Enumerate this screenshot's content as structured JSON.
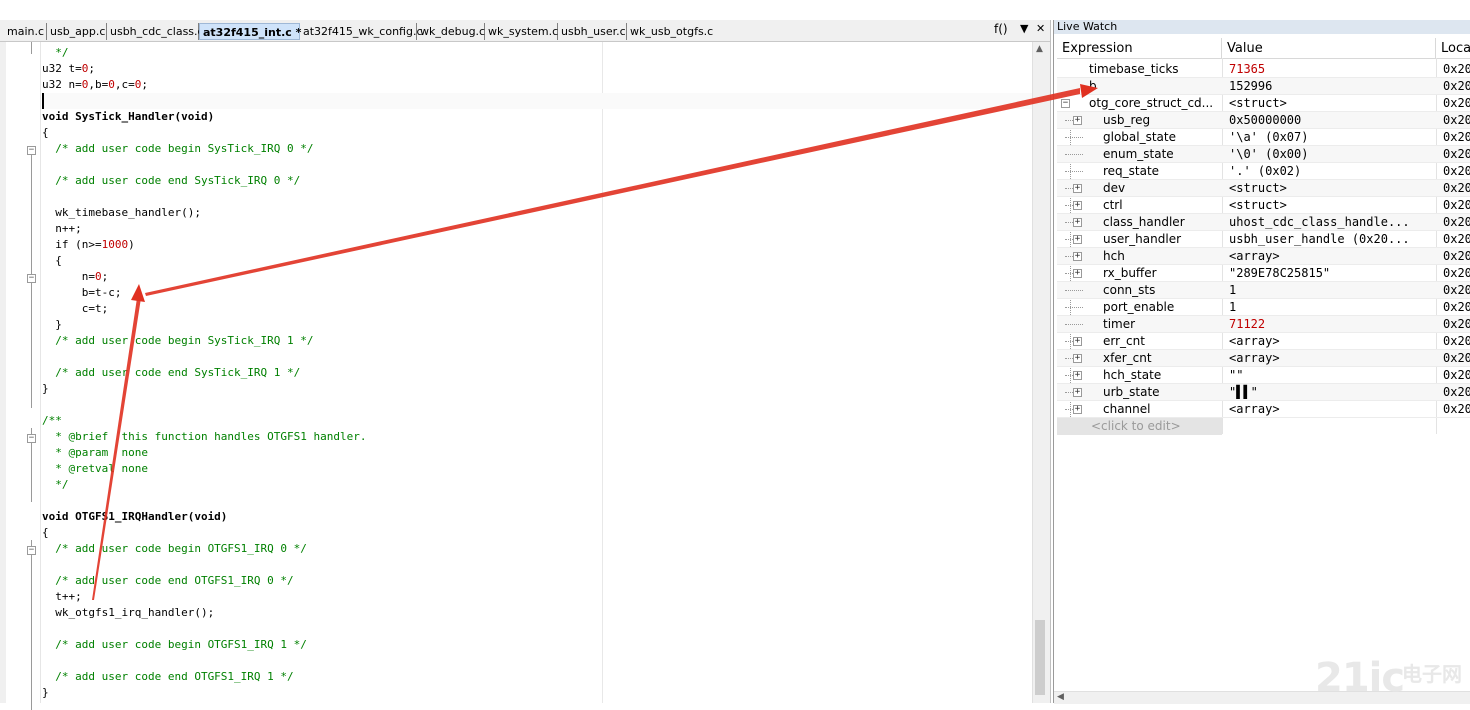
{
  "tabs": [
    {
      "label": "main.c"
    },
    {
      "label": "usb_app.c"
    },
    {
      "label": "usbh_cdc_class.c"
    },
    {
      "label": "at32f415_int.c *",
      "active": true
    },
    {
      "label": "at32f415_wk_config.c"
    },
    {
      "label": "wk_debug.c"
    },
    {
      "label": "wk_system.c"
    },
    {
      "label": "usbh_user.c"
    },
    {
      "label": "wk_usb_otgfs.c"
    }
  ],
  "func_selector": "f()",
  "code_lines": [
    "  */",
    "u32 t=0;",
    "u32 n=0,b=0,c=0;",
    "",
    "void SysTick_Handler(void)",
    "{",
    "  /* add user code begin SysTick_IRQ 0 */",
    "",
    "  /* add user code end SysTick_IRQ 0 */",
    "",
    "  wk_timebase_handler();",
    "  n++;",
    "  if (n>=1000)",
    "  {",
    "      n=0;",
    "      b=t-c;",
    "      c=t;",
    "  }",
    "  /* add user code begin SysTick_IRQ 1 */",
    "",
    "  /* add user code end SysTick_IRQ 1 */",
    "}",
    "",
    "/**",
    "  * @brief  this function handles OTGFS1 handler.",
    "  * @param  none",
    "  * @retval none",
    "  */",
    "",
    "void OTGFS1_IRQHandler(void)",
    "{",
    "  /* add user code begin OTGFS1_IRQ 0 */",
    "",
    "  /* add user code end OTGFS1_IRQ 0 */",
    "  t++;",
    "  wk_otgfs1_irq_handler();",
    "",
    "  /* add user code begin OTGFS1_IRQ 1 */",
    "",
    "  /* add user code end OTGFS1_IRQ 1 */",
    "}"
  ],
  "watch": {
    "title": "Live Watch",
    "headers": {
      "expression": "Expression",
      "value": "Value",
      "location": "Loca"
    },
    "rows": [
      {
        "name": "timebase_ticks",
        "value": "71365",
        "loc": "0x20",
        "changed": true
      },
      {
        "name": "b",
        "value": "152996",
        "loc": "0x20"
      },
      {
        "name": "otg_core_struct_cd...",
        "value": "<struct>",
        "loc": "0x20",
        "expand": "minus"
      },
      {
        "name": "usb_reg",
        "value": "0x50000000",
        "loc": "0x20",
        "expand": "plus"
      },
      {
        "name": "global_state",
        "value": "'\\a' (0x07)",
        "loc": "0x20"
      },
      {
        "name": "enum_state",
        "value": "'\\0' (0x00)",
        "loc": "0x20"
      },
      {
        "name": "req_state",
        "value": "'.' (0x02)",
        "loc": "0x20"
      },
      {
        "name": "dev",
        "value": "<struct>",
        "loc": "0x20",
        "expand": "plus"
      },
      {
        "name": "ctrl",
        "value": "<struct>",
        "loc": "0x20",
        "expand": "plus"
      },
      {
        "name": "class_handler",
        "value": "uhost_cdc_class_handle...",
        "loc": "0x20",
        "expand": "plus"
      },
      {
        "name": "user_handler",
        "value": "usbh_user_handle (0x20...",
        "loc": "0x20",
        "expand": "plus"
      },
      {
        "name": "hch",
        "value": "<array>",
        "loc": "0x20",
        "expand": "plus"
      },
      {
        "name": "rx_buffer",
        "value": "\"289E78C25815\"",
        "loc": "0x20",
        "expand": "plus"
      },
      {
        "name": "conn_sts",
        "value": "1",
        "loc": "0x20"
      },
      {
        "name": "port_enable",
        "value": "1",
        "loc": "0x20"
      },
      {
        "name": "timer",
        "value": "71122",
        "loc": "0x20",
        "changed": true
      },
      {
        "name": "err_cnt",
        "value": "<array>",
        "loc": "0x20",
        "expand": "plus"
      },
      {
        "name": "xfer_cnt",
        "value": "<array>",
        "loc": "0x20",
        "expand": "plus"
      },
      {
        "name": "hch_state",
        "value": "\"\"",
        "loc": "0x20",
        "expand": "plus"
      },
      {
        "name": "urb_state",
        "value": "\"▌▌\"",
        "loc": "0x20",
        "expand": "plus"
      },
      {
        "name": "channel",
        "value": "<array>",
        "loc": "0x20",
        "expand": "plus"
      }
    ],
    "click_to_edit": "<click to edit>"
  },
  "watermark": {
    "main": "21ic",
    "sub": "电子网"
  },
  "colors": {
    "comment": "#008000",
    "number": "#c00000",
    "annotation_arrow": "#e03020"
  }
}
